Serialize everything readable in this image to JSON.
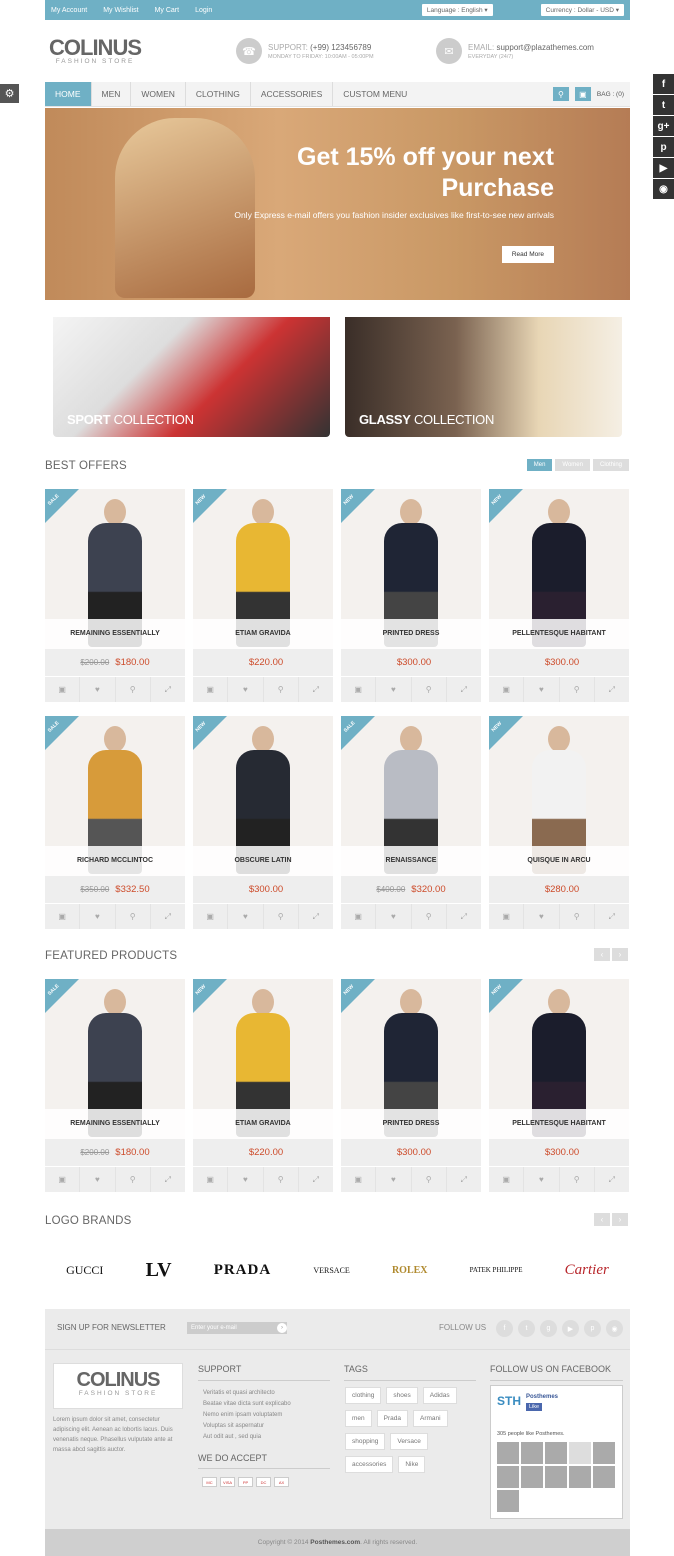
{
  "topbar": {
    "links": [
      "My Account",
      "My Wishlist",
      "My Cart",
      "Login"
    ],
    "language": "Language : English ▾",
    "currency": "Currency : Dollar - USD ▾"
  },
  "header": {
    "logo_title": "COLINUS",
    "logo_sub": "FASHION STORE",
    "support_label": "SUPPORT:",
    "support_phone": "(+99) 123456789",
    "support_hours": "MONDAY TO FRIDAY: 10:00AM - 05:00PM",
    "email_label": "EMAIL:",
    "email_value": "support@plazathemes.com",
    "email_note": "EVERYDAY (24/7)"
  },
  "nav": {
    "items": [
      "HOME",
      "MEN",
      "WOMEN",
      "CLOTHING",
      "ACCESSORIES",
      "CUSTOM MENU"
    ],
    "bag": "BAG : (0)"
  },
  "hero": {
    "title_line1": "Get 15% off your next",
    "title_line2": "Purchase",
    "text": "Only Express e-mail offers you fashion insider exclusives like first-to-see new arrivals",
    "button": "Read More"
  },
  "banners": [
    {
      "bold": "SPORT",
      "rest": " COLLECTION"
    },
    {
      "bold": "GLASSY",
      "rest": " COLLECTION"
    }
  ],
  "best_offers": {
    "title": "BEST OFFERS",
    "tabs": [
      "Men",
      "Women",
      "Clothing"
    ],
    "products": [
      {
        "badge": "SALE",
        "name": "REMAINING ESSENTIALLY",
        "old": "$200.00",
        "price": "$180.00"
      },
      {
        "badge": "NEW",
        "name": "ETIAM GRAVIDA",
        "old": "",
        "price": "$220.00"
      },
      {
        "badge": "NEW",
        "name": "PRINTED DRESS",
        "old": "",
        "price": "$300.00"
      },
      {
        "badge": "NEW",
        "name": "PELLENTESQUE HABITANT",
        "old": "",
        "price": "$300.00"
      },
      {
        "badge": "SALE",
        "name": "RICHARD MCCLINTOC",
        "old": "$350.00",
        "price": "$332.50"
      },
      {
        "badge": "NEW",
        "name": "OBSCURE LATIN",
        "old": "",
        "price": "$300.00"
      },
      {
        "badge": "SALE",
        "name": "RENAISSANCE",
        "old": "$400.00",
        "price": "$320.00"
      },
      {
        "badge": "NEW",
        "name": "QUISQUE IN ARCU",
        "old": "",
        "price": "$280.00"
      }
    ]
  },
  "featured": {
    "title": "FEATURED PRODUCTS",
    "products": [
      {
        "badge": "SALE",
        "name": "REMAINING ESSENTIALLY",
        "old": "$200.00",
        "price": "$180.00"
      },
      {
        "badge": "NEW",
        "name": "ETIAM GRAVIDA",
        "old": "",
        "price": "$220.00"
      },
      {
        "badge": "NEW",
        "name": "PRINTED DRESS",
        "old": "",
        "price": "$300.00"
      },
      {
        "badge": "NEW",
        "name": "PELLENTESQUE HABITANT",
        "old": "",
        "price": "$300.00"
      }
    ]
  },
  "brands": {
    "title": "LOGO BRANDS",
    "items": [
      "GUCCI",
      "LV",
      "PRADA",
      "VERSACE",
      "ROLEX",
      "PATEK PHILIPPE",
      "Cartier"
    ]
  },
  "footer": {
    "newsletter": "SIGN UP FOR NEWSLETTER",
    "newsletter_placeholder": "Enter your e-mail",
    "follow": "FOLLOW US",
    "about": "Lorem ipsum dolor sit amet, consectetur adipiscing elit. Aenean ac lobortis lacus. Duis venenatis neque. Phasellus vulputate ante at massa abcd sagittis auctor.",
    "support_title": "SUPPORT",
    "support_items": [
      "Veritatis et quasi architecto",
      "Beatae vitae dicta sunt explicabo",
      "Nemo enim ipsam voluptatem",
      "Voluptas sit aspernatur",
      "Aut odit aut , sed quia"
    ],
    "accept_title": "WE DO ACCEPT",
    "tags_title": "TAGS",
    "tags": [
      "clothing",
      "shoes",
      "Adidas",
      "men",
      "Prada",
      "Armani",
      "shopping",
      "Versace",
      "accessories",
      "Nike"
    ],
    "fb_title": "FOLLOW US ON FACEBOOK",
    "fb_page": "Posthemes",
    "fb_like": "Like",
    "fb_count": "305 people like Posthemes.",
    "copyright_pre": "Copyright © 2014 ",
    "copyright_brand": "Posthemes.com",
    "copyright_post": ". All rights reserved."
  },
  "colors": {
    "accent": "#6fb0c5",
    "price": "#cd4b2a"
  }
}
